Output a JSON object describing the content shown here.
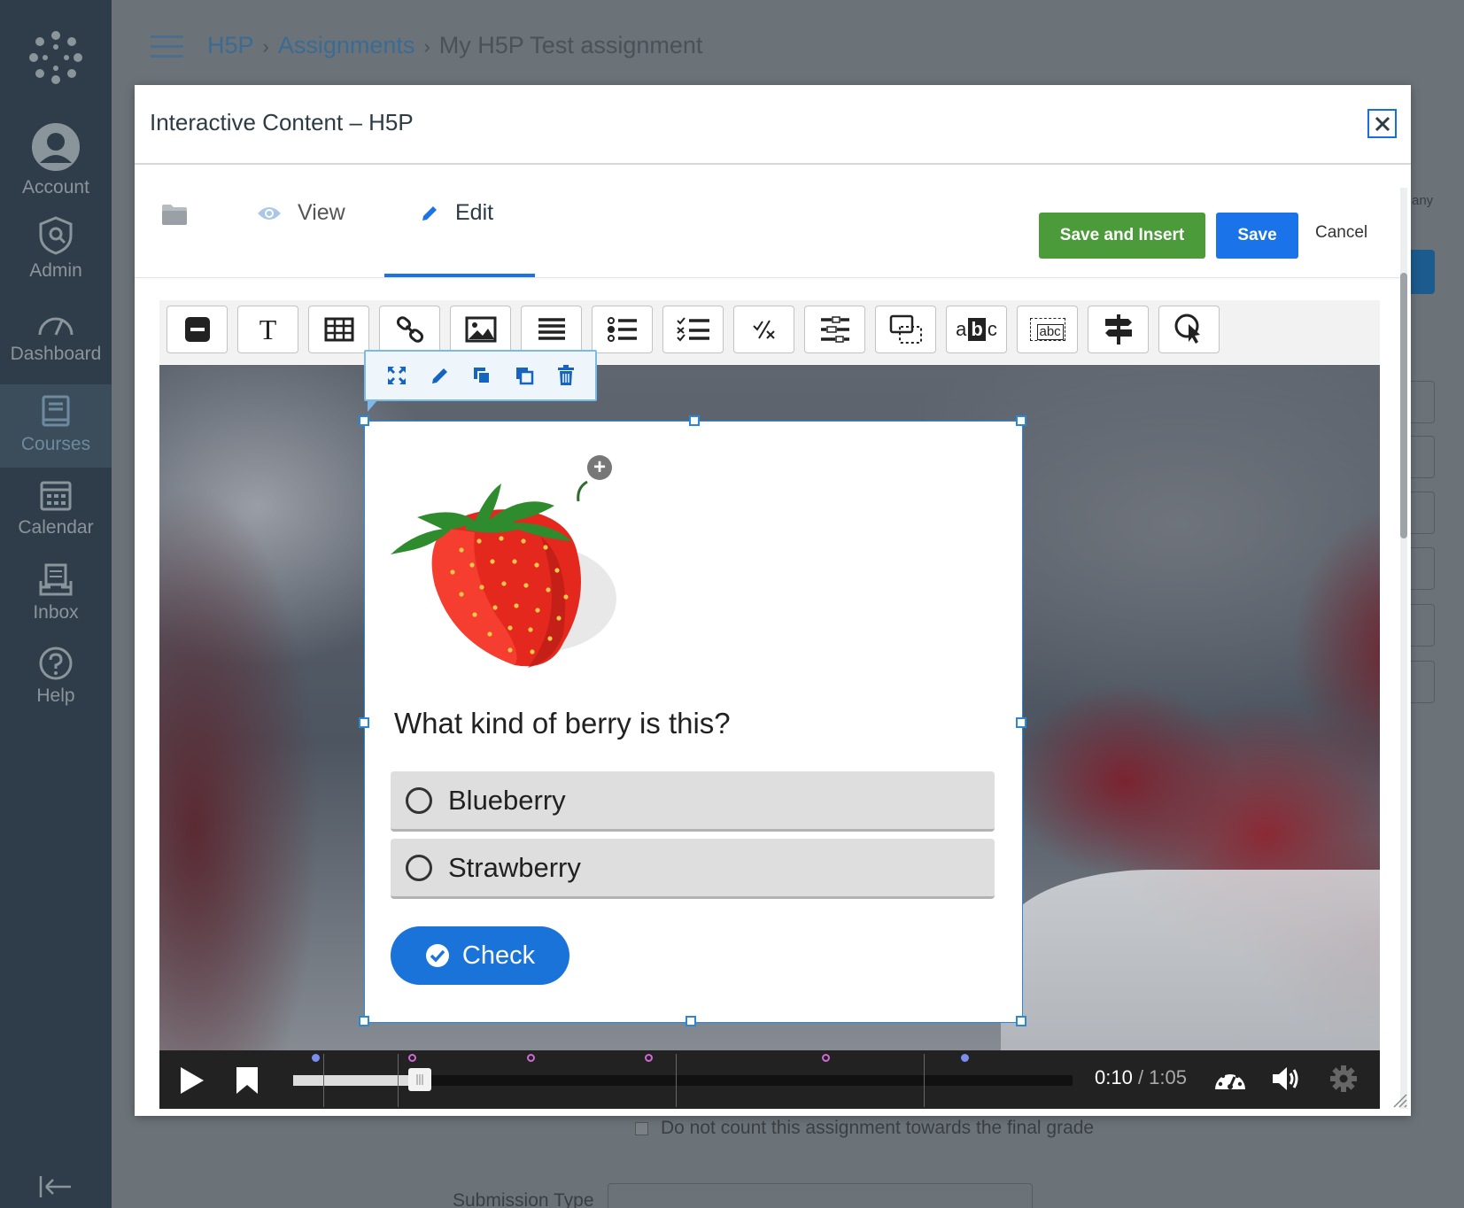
{
  "global_nav": {
    "items": [
      {
        "label": "Account",
        "icon": "user-avatar-icon"
      },
      {
        "label": "Admin",
        "icon": "shield-icon"
      },
      {
        "label": "Dashboard",
        "icon": "dashboard-icon"
      },
      {
        "label": "Courses",
        "icon": "book-icon",
        "active": true
      },
      {
        "label": "Calendar",
        "icon": "calendar-icon"
      },
      {
        "label": "Inbox",
        "icon": "inbox-icon"
      },
      {
        "label": "Help",
        "icon": "help-icon"
      }
    ],
    "collapse_icon": "collapse-arrow-icon"
  },
  "breadcrumbs": [
    "H5P",
    "Assignments",
    "My H5P Test assignment"
  ],
  "background_page": {
    "checkbox_label": "Do not count this assignment towards the final grade",
    "submission_type_label": "Submission Type",
    "side_text": "any"
  },
  "modal": {
    "title": "Interactive Content – H5P",
    "close_icon": "close-icon",
    "tabs": [
      {
        "label": "View",
        "icon": "eye-icon"
      },
      {
        "label": "Edit",
        "icon": "pencil-icon",
        "active": true
      }
    ],
    "buttons": {
      "save_and_insert": "Save and Insert",
      "save": "Save",
      "cancel": "Cancel"
    }
  },
  "editor_toolbar": {
    "tools": [
      "label-tool-icon",
      "text-tool-icon",
      "table-tool-icon",
      "link-tool-icon",
      "image-tool-icon",
      "statements-tool-icon",
      "single-choice-tool-icon",
      "multiple-choice-tool-icon",
      "true-false-tool-icon",
      "fill-in-blanks-tool-icon",
      "drag-and-drop-tool-icon",
      "mark-words-tool-icon",
      "drag-text-tool-icon",
      "crossroads-tool-icon",
      "navigation-hotspot-tool-icon"
    ],
    "text_tool_glyph": "T",
    "mark_words_glyph_left": "a",
    "mark_words_glyph_mid": "b",
    "mark_words_glyph_right": "c",
    "drag_text_glyph": "abc"
  },
  "element_toolbar": [
    "fullscreen-icon",
    "edit-icon",
    "bring-to-front-icon",
    "send-to-back-icon",
    "delete-icon"
  ],
  "interaction": {
    "question": "What kind of berry is this?",
    "answers": [
      "Blueberry",
      "Strawberry"
    ],
    "check_label": "Check"
  },
  "player": {
    "current_time": "0:10",
    "separator": " / ",
    "duration": "1:05",
    "progress": 0.152,
    "colors": {
      "bookmark_dot": "#7b8ef0",
      "interaction_dot": "#d06ad7"
    }
  },
  "colors": {
    "nav_bg": "#2f3d4a",
    "save_insert_green": "#4b9b3a",
    "save_blue": "#1a73e8",
    "check_blue": "#1a73d9",
    "selection_blue": "#2a88d6"
  }
}
